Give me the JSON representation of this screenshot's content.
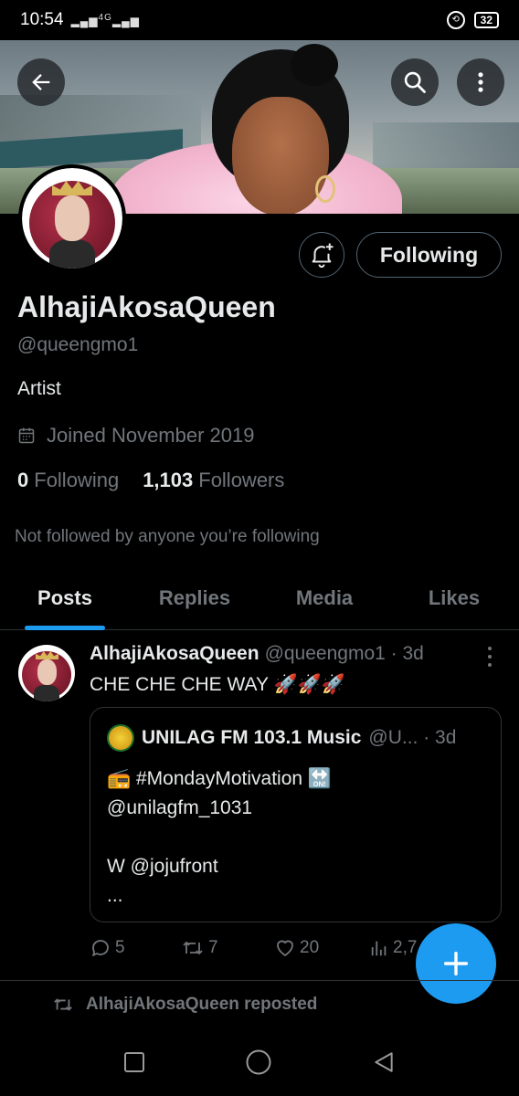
{
  "status_bar": {
    "time": "10:54",
    "signal_label": "4G",
    "battery": "32"
  },
  "profile": {
    "name": "AlhajiAkosaQueen",
    "handle": "@queengmo1",
    "bio": "Artist",
    "joined": "Joined November 2019",
    "following_count": "0",
    "following_label": "Following",
    "followers_count": "1,103",
    "followers_label": "Followers",
    "not_followed_text": "Not followed by anyone you’re following",
    "follow_button_label": "Following"
  },
  "tabs": [
    {
      "label": "Posts",
      "active": true
    },
    {
      "label": "Replies",
      "active": false
    },
    {
      "label": "Media",
      "active": false
    },
    {
      "label": "Likes",
      "active": false
    }
  ],
  "post": {
    "author": "AlhajiAkosaQueen",
    "handle_time": "@queengmo1 · 3d",
    "text": "CHE CHE CHE WAY 🚀🚀🚀",
    "quote": {
      "author": "UNILAG FM 103.1 Music",
      "handle_time": "@U... · 3d",
      "body": "📻 #MondayMotivation 🔛\n@unilagfm_1031\n\nW @jojufront\n..."
    },
    "stats": {
      "replies": "5",
      "reposts": "7",
      "likes": "20",
      "views": "2,7"
    }
  },
  "repost_notice": "AlhajiAkosaQueen reposted",
  "colors": {
    "accent": "#1d9bf0",
    "background": "#000000",
    "text_primary": "#e7e9ea",
    "text_secondary": "#71767b",
    "border": "#2f3336"
  },
  "icons": [
    "back-arrow-icon",
    "search-icon",
    "more-vertical-icon",
    "bell-plus-icon",
    "calendar-icon",
    "reply-icon",
    "retweet-icon",
    "heart-icon",
    "views-icon",
    "plus-icon",
    "square-nav-icon",
    "circle-nav-icon",
    "triangle-back-nav-icon"
  ]
}
